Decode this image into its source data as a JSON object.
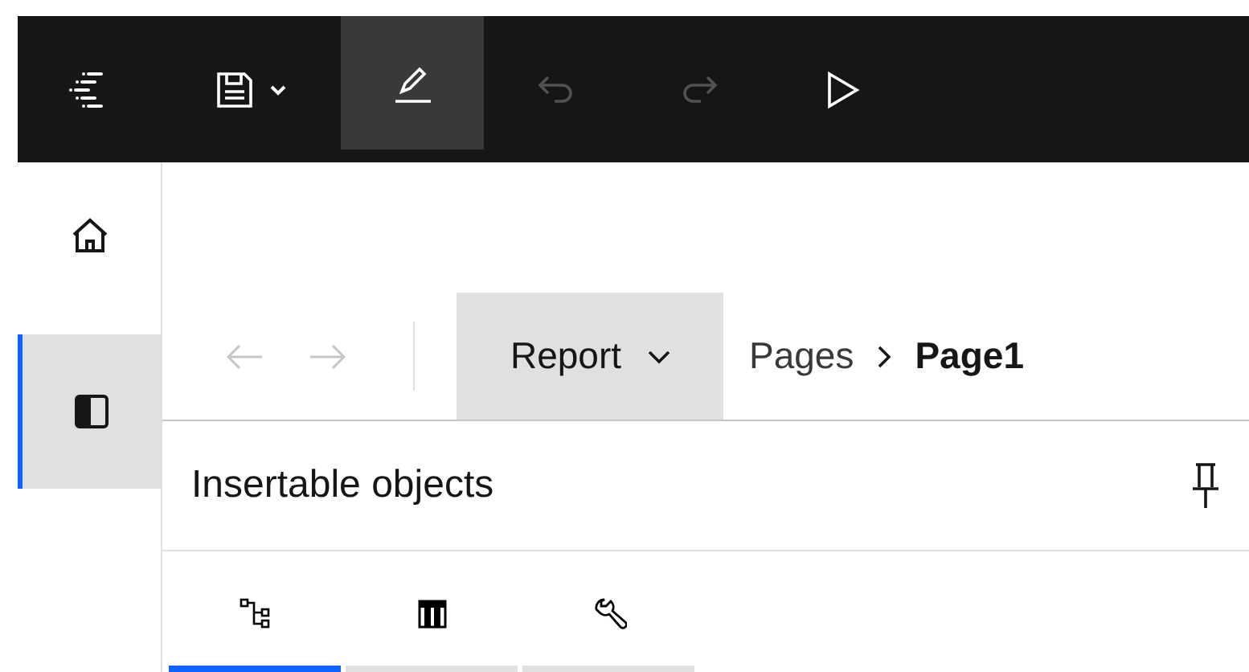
{
  "toolbar": {
    "buttons": [
      {
        "kind": "menu",
        "selected": false,
        "disabled": false
      },
      {
        "kind": "save",
        "selected": false,
        "disabled": false
      },
      {
        "kind": "edit",
        "selected": true,
        "disabled": false
      },
      {
        "kind": "undo",
        "selected": false,
        "disabled": true
      },
      {
        "kind": "redo",
        "selected": false,
        "disabled": true
      },
      {
        "kind": "run",
        "selected": false,
        "disabled": false
      }
    ]
  },
  "sidebar": {
    "items": [
      {
        "kind": "home",
        "selected": false
      },
      {
        "kind": "panel",
        "selected": true
      }
    ]
  },
  "breadcrumb": {
    "back_disabled": true,
    "forward_disabled": true,
    "dropdown": "Report",
    "items": [
      {
        "label": "Pages",
        "current": false
      },
      {
        "label": "Page1",
        "current": true
      }
    ]
  },
  "panel": {
    "title": "Insertable objects",
    "tabs": [
      {
        "kind": "tree",
        "selected": true
      },
      {
        "kind": "table",
        "selected": false
      },
      {
        "kind": "tools",
        "selected": false
      }
    ]
  }
}
